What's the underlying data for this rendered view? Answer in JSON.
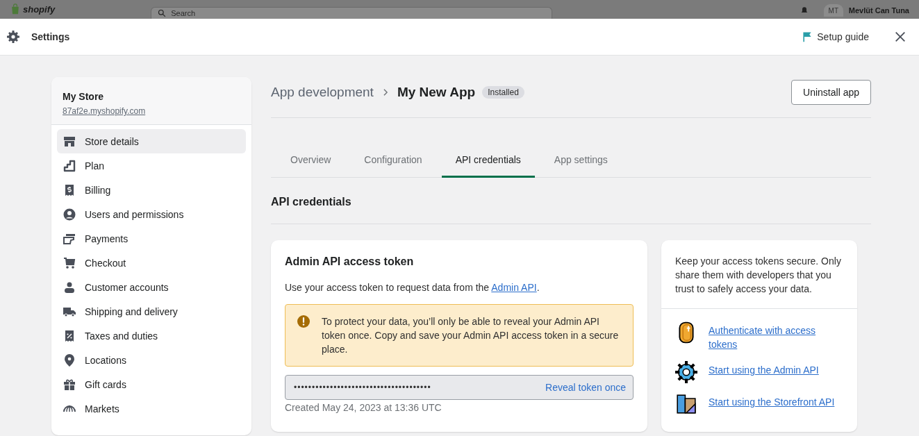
{
  "backdrop": {
    "logo": "shopify",
    "search": {
      "placeholder": "Search"
    },
    "user": {
      "initials": "MT",
      "name": "Mevlüt Can Tuna"
    }
  },
  "window": {
    "title": "Settings",
    "setup_guide": "Setup guide"
  },
  "sidebar": {
    "store_name": "My Store",
    "store_url": "87af2e.myshopify.com",
    "items": [
      {
        "label": "Store details",
        "selected": true
      },
      {
        "label": "Plan",
        "selected": false
      },
      {
        "label": "Billing",
        "selected": false
      },
      {
        "label": "Users and permissions",
        "selected": false
      },
      {
        "label": "Payments",
        "selected": false
      },
      {
        "label": "Checkout",
        "selected": false
      },
      {
        "label": "Customer accounts",
        "selected": false
      },
      {
        "label": "Shipping and delivery",
        "selected": false
      },
      {
        "label": "Taxes and duties",
        "selected": false
      },
      {
        "label": "Locations",
        "selected": false
      },
      {
        "label": "Gift cards",
        "selected": false
      },
      {
        "label": "Markets",
        "selected": false
      }
    ]
  },
  "header": {
    "breadcrumb": "App development",
    "title": "My New App",
    "badge": "Installed",
    "action": "Uninstall app"
  },
  "tabs": [
    {
      "label": "Overview",
      "selected": false
    },
    {
      "label": "Configuration",
      "selected": false
    },
    {
      "label": "API credentials",
      "selected": true
    },
    {
      "label": "App settings",
      "selected": false
    }
  ],
  "section_title": "API credentials",
  "token_card": {
    "title": "Admin API access token",
    "description": "Use your access token to request data from the ",
    "link": "Admin API",
    "description_end": ".",
    "warning": "To protect your data, you’ll only be able to reveal your Admin API token once. Copy and save your Admin API access token in a secure place.",
    "token": "••••••••••••••••••••••••••••••••••••••",
    "reveal": "Reveal token once",
    "created": "Created May 24, 2023 at 13:36 UTC"
  },
  "tips_card": {
    "text": "Keep your access tokens secure. Only share them with developers that you trust to safely access your data.",
    "links": [
      {
        "label": "Authenticate with access tokens"
      },
      {
        "label": "Start using the Admin API"
      },
      {
        "label": "Start using the Storefront API"
      }
    ]
  }
}
